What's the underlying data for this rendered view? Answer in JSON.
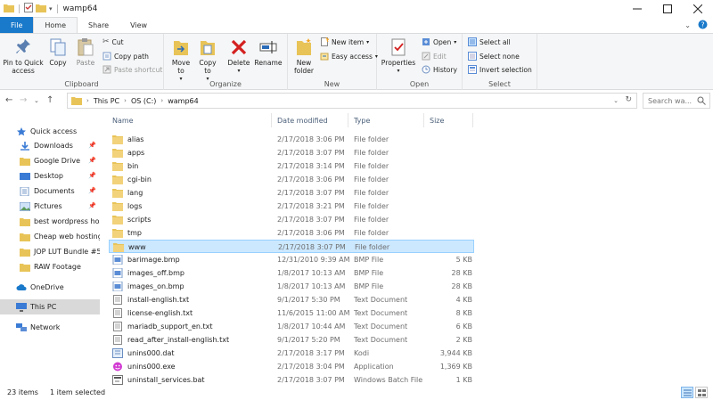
{
  "window": {
    "title": "wamp64"
  },
  "ribbon_tabs": [
    "File",
    "Home",
    "Share",
    "View"
  ],
  "ribbon": {
    "clipboard": {
      "pin_label": "Pin to Quick access",
      "copy_label": "Copy",
      "paste_label": "Paste",
      "cut_label": "Cut",
      "copy_path_label": "Copy path",
      "paste_shortcut_label": "Paste shortcut",
      "group_label": "Clipboard"
    },
    "organize": {
      "move_to_label": "Move to",
      "copy_to_label": "Copy to",
      "delete_label": "Delete",
      "rename_label": "Rename",
      "group_label": "Organize"
    },
    "new": {
      "new_folder_label": "New folder",
      "new_item_label": "New item",
      "easy_access_label": "Easy access",
      "group_label": "New"
    },
    "open": {
      "properties_label": "Properties",
      "open_label": "Open",
      "edit_label": "Edit",
      "history_label": "History",
      "group_label": "Open"
    },
    "select": {
      "select_all_label": "Select all",
      "select_none_label": "Select none",
      "invert_label": "Invert selection",
      "group_label": "Select"
    }
  },
  "address": {
    "crumbs": [
      "This PC",
      "OS (C:)",
      "wamp64"
    ],
    "search_placeholder": "Search wa..."
  },
  "nav": {
    "quick_access": "Quick access",
    "items": [
      {
        "label": "Downloads",
        "pinned": true
      },
      {
        "label": "Google Drive",
        "pinned": true
      },
      {
        "label": "Desktop",
        "pinned": true
      },
      {
        "label": "Documents",
        "pinned": true
      },
      {
        "label": "Pictures",
        "pinned": true
      },
      {
        "label": "best wordpress host",
        "pinned": false
      },
      {
        "label": "Cheap web hosting",
        "pinned": false
      },
      {
        "label": "JOP LUT Bundle #5",
        "pinned": false
      },
      {
        "label": "RAW Footage",
        "pinned": false
      }
    ],
    "onedrive": "OneDrive",
    "this_pc": "This PC",
    "network": "Network"
  },
  "columns": {
    "name": "Name",
    "date": "Date modified",
    "type": "Type",
    "size": "Size"
  },
  "files": [
    {
      "name": "alias",
      "date": "2/17/2018 3:06 PM",
      "type": "File folder",
      "size": "",
      "icon": "folder"
    },
    {
      "name": "apps",
      "date": "2/17/2018 3:07 PM",
      "type": "File folder",
      "size": "",
      "icon": "folder"
    },
    {
      "name": "bin",
      "date": "2/17/2018 3:14 PM",
      "type": "File folder",
      "size": "",
      "icon": "folder"
    },
    {
      "name": "cgi-bin",
      "date": "2/17/2018 3:06 PM",
      "type": "File folder",
      "size": "",
      "icon": "folder"
    },
    {
      "name": "lang",
      "date": "2/17/2018 3:07 PM",
      "type": "File folder",
      "size": "",
      "icon": "folder"
    },
    {
      "name": "logs",
      "date": "2/17/2018 3:21 PM",
      "type": "File folder",
      "size": "",
      "icon": "folder"
    },
    {
      "name": "scripts",
      "date": "2/17/2018 3:07 PM",
      "type": "File folder",
      "size": "",
      "icon": "folder"
    },
    {
      "name": "tmp",
      "date": "2/17/2018 3:06 PM",
      "type": "File folder",
      "size": "",
      "icon": "folder"
    },
    {
      "name": "www",
      "date": "2/17/2018 3:07 PM",
      "type": "File folder",
      "size": "",
      "icon": "folder",
      "selected": true
    },
    {
      "name": "barimage.bmp",
      "date": "12/31/2010 9:39 AM",
      "type": "BMP File",
      "size": "5 KB",
      "icon": "image"
    },
    {
      "name": "images_off.bmp",
      "date": "1/8/2017 10:13 AM",
      "type": "BMP File",
      "size": "28 KB",
      "icon": "image"
    },
    {
      "name": "images_on.bmp",
      "date": "1/8/2017 10:13 AM",
      "type": "BMP File",
      "size": "28 KB",
      "icon": "image"
    },
    {
      "name": "install-english.txt",
      "date": "9/1/2017 5:30 PM",
      "type": "Text Document",
      "size": "4 KB",
      "icon": "text"
    },
    {
      "name": "license-english.txt",
      "date": "11/6/2015 11:00 AM",
      "type": "Text Document",
      "size": "8 KB",
      "icon": "text"
    },
    {
      "name": "mariadb_support_en.txt",
      "date": "1/8/2017 10:44 AM",
      "type": "Text Document",
      "size": "6 KB",
      "icon": "text"
    },
    {
      "name": "read_after_install-english.txt",
      "date": "9/1/2017 5:20 PM",
      "type": "Text Document",
      "size": "2 KB",
      "icon": "text"
    },
    {
      "name": "unins000.dat",
      "date": "2/17/2018 3:17 PM",
      "type": "Kodi",
      "size": "3,944 KB",
      "icon": "dat"
    },
    {
      "name": "unins000.exe",
      "date": "2/17/2018 3:04 PM",
      "type": "Application",
      "size": "1,369 KB",
      "icon": "exe"
    },
    {
      "name": "uninstall_services.bat",
      "date": "2/17/2018 3:07 PM",
      "type": "Windows Batch File",
      "size": "1 KB",
      "icon": "bat"
    }
  ],
  "status": {
    "count": "23 items",
    "selected": "1 item selected"
  },
  "colors": {
    "file_tab": "#1979ca",
    "selection": "#cce8ff",
    "folder": "#e8c458"
  }
}
